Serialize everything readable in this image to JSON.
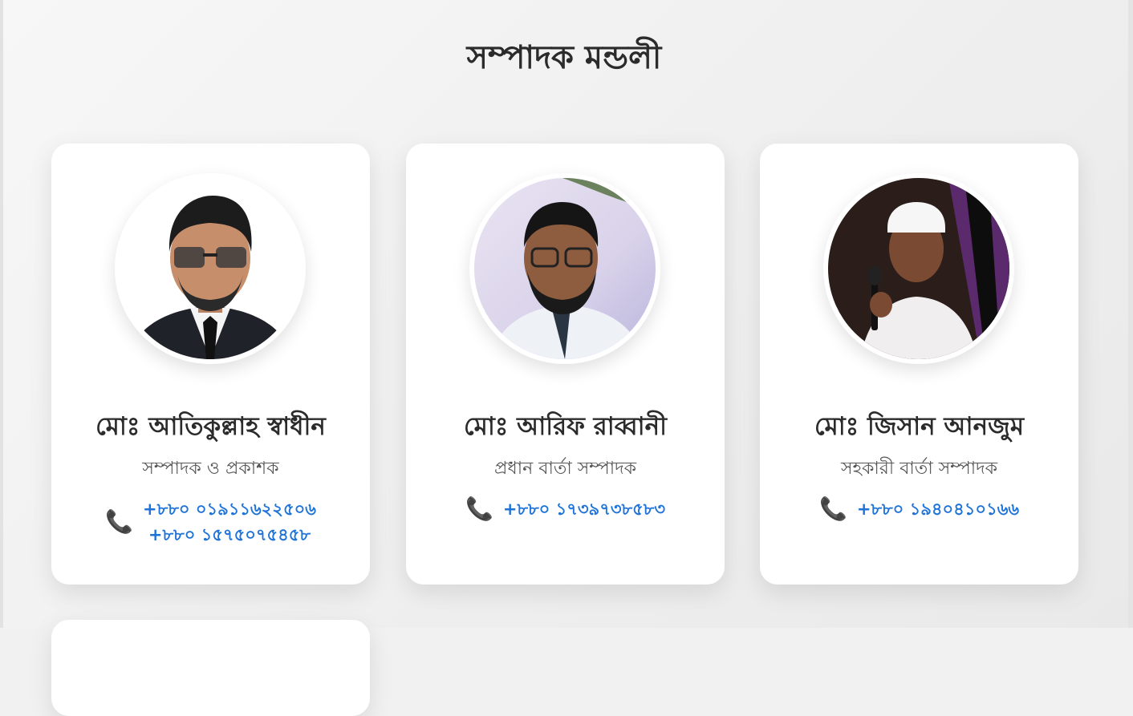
{
  "section": {
    "title": "সম্পাদক মন্ডলী"
  },
  "members": [
    {
      "name": "মোঃ আতিকুল্লাহ স্বাধীন",
      "role": "সম্পাদক ও প্রকাশক",
      "phone_icon": "phone-icon",
      "phones": [
        "+৮৮০ ০১৯১১৬২২৫০৬",
        "+৮৮০ ১৫৭৫০৭৫৪৫৮"
      ]
    },
    {
      "name": "মোঃ আরিফ রাব্বানী",
      "role": "প্রধান বার্তা সম্পাদক",
      "phone_icon": "phone-icon",
      "phones": [
        "+৮৮০ ১৭৩৯৭৩৮৫৮৩"
      ]
    },
    {
      "name": "মোঃ জিসান আনজুম",
      "role": "সহকারী বার্তা সম্পাদক",
      "phone_icon": "phone-icon",
      "phones": [
        "+৮৮০ ১৯৪০৪১০১৬৬"
      ]
    }
  ],
  "colors": {
    "accent": "#1e73d8",
    "title": "#2b2b2b",
    "subtitle": "#555555",
    "card": "#ffffff",
    "background": "#f1f1f1"
  }
}
